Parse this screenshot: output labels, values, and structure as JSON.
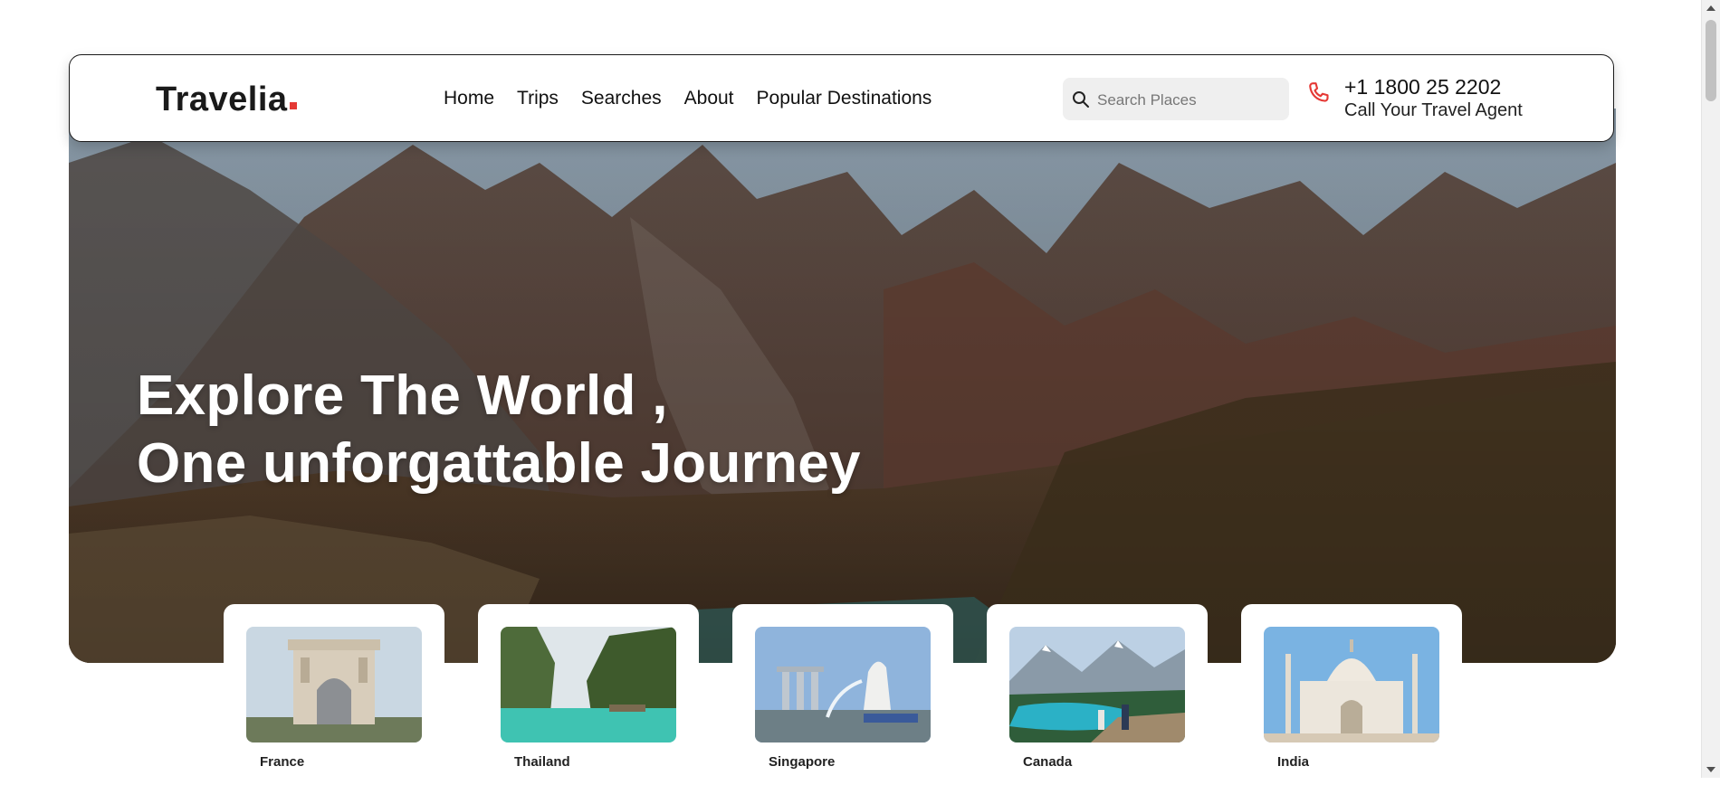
{
  "brand": {
    "name": "Travelia",
    "dot_color": "#e53935"
  },
  "nav": {
    "links": [
      "Home",
      "Trips",
      "Searches",
      "About",
      "Popular Destinations"
    ]
  },
  "search": {
    "placeholder": "Search Places",
    "value": ""
  },
  "contact": {
    "phone": "+1 1800 25 2202",
    "caption": "Call Your Travel Agent",
    "icon": "phone-icon",
    "icon_color": "#e53935"
  },
  "hero": {
    "title_line1": "Explore The World ,",
    "title_line2": "One unforgattable Journey"
  },
  "destinations": [
    {
      "name": "France",
      "image": "arc-de-triomphe"
    },
    {
      "name": "Thailand",
      "image": "thai-lagoon"
    },
    {
      "name": "Singapore",
      "image": "merlion-marina-bay"
    },
    {
      "name": "Canada",
      "image": "turquoise-lake-mountains"
    },
    {
      "name": "India",
      "image": "taj-mahal"
    }
  ]
}
